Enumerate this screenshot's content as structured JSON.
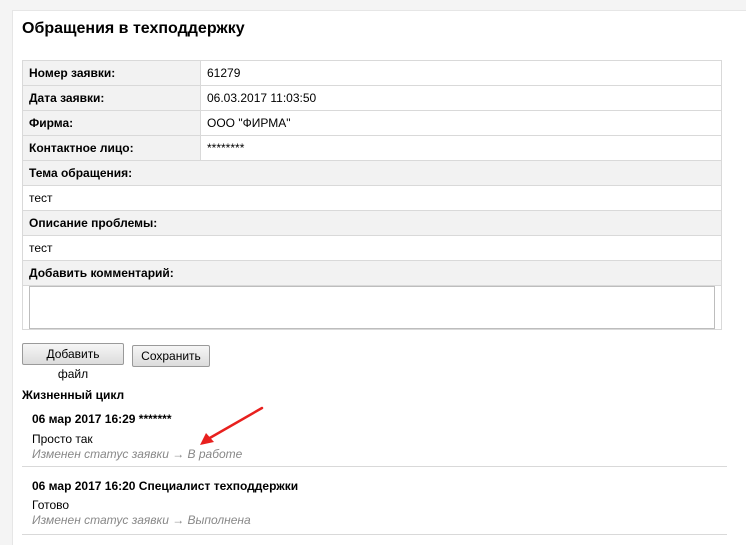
{
  "page": {
    "title": "Обращения в техподдержку"
  },
  "ticket": {
    "fields": [
      {
        "label": "Номер заявки:",
        "value": "61279"
      },
      {
        "label": "Дата заявки:",
        "value": "06.03.2017 11:03:50"
      },
      {
        "label": "Фирма:",
        "value": "ООО \"ФИРМА\""
      },
      {
        "label": "Контактное лицо:",
        "value": "********"
      }
    ],
    "subject": {
      "label": "Тема обращения:",
      "value": "тест"
    },
    "description": {
      "label": "Описание проблемы:",
      "value": "тест"
    },
    "comment": {
      "label": "Добавить комментарий:",
      "value": ""
    }
  },
  "buttons": {
    "add_file": "Добавить файл",
    "save": "Сохранить"
  },
  "lifecycle": {
    "title": "Жизненный цикл",
    "entries": [
      {
        "header": "06 мар 2017 16:29 *******",
        "message": "Просто так",
        "status": "Изменен статус заявки → В работе"
      },
      {
        "header": "06 мар 2017 16:20 Специалист техподдержки",
        "message": "Готово",
        "status": "Изменен статус заявки → Выполнена"
      }
    ]
  },
  "colors": {
    "arrow": "#e8201e",
    "status_text": "#888888",
    "label_bg": "#f2f2f2"
  },
  "icons": {
    "annotation": "red-arrow-icon"
  }
}
